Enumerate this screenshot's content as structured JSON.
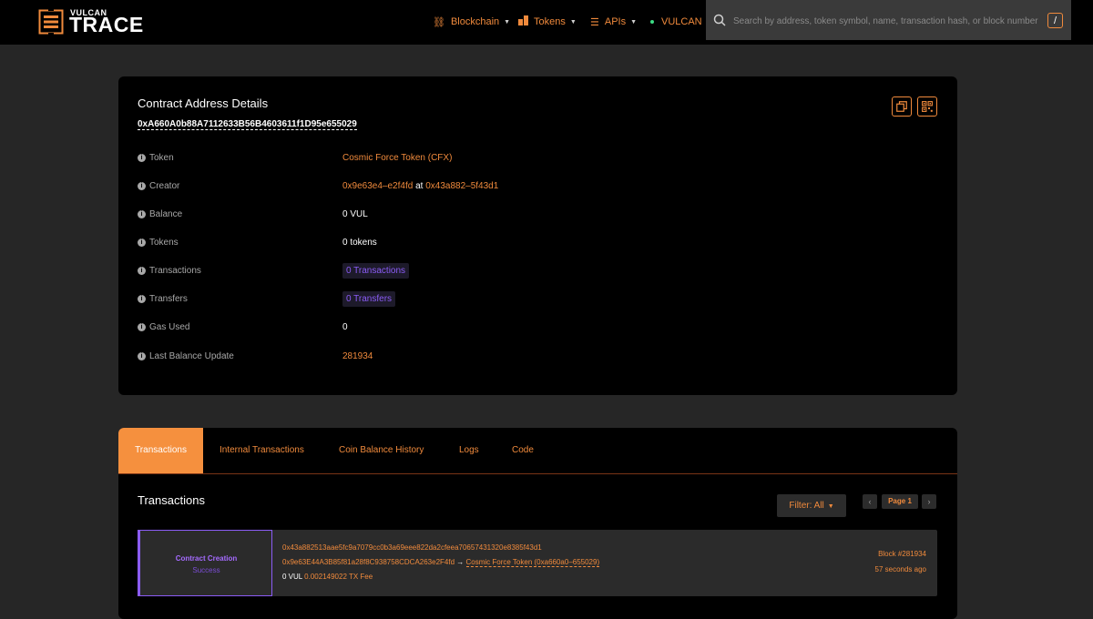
{
  "brand": {
    "small": "VULCAN",
    "big": "TRACE"
  },
  "nav": {
    "blockchain": "Blockchain",
    "tokens": "Tokens",
    "apis": "APIs",
    "network": "VULCAN"
  },
  "search": {
    "placeholder": "Search by address, token symbol, name, transaction hash, or block number",
    "shortcut": "/"
  },
  "details": {
    "title": "Contract Address Details",
    "address": "0xA660A0b88A7112633B56B4603611f1D95e655029",
    "rows": {
      "token": {
        "label": "Token",
        "value": "Cosmic Force Token (CFX)"
      },
      "creator": {
        "label": "Creator",
        "creator": "0x9e63e4–e2f4fd",
        "at": "at",
        "tx": "0x43a882–5f43d1"
      },
      "balance": {
        "label": "Balance",
        "value": "0 VUL"
      },
      "tokens": {
        "label": "Tokens",
        "value": "0 tokens"
      },
      "transactions": {
        "label": "Transactions",
        "value": "0 Transactions"
      },
      "transfers": {
        "label": "Transfers",
        "value": "0 Transfers"
      },
      "gas": {
        "label": "Gas Used",
        "value": "0"
      },
      "last_update": {
        "label": "Last Balance Update",
        "value": "281934"
      }
    }
  },
  "tabs": {
    "transactions": "Transactions",
    "internal": "Internal Transactions",
    "coin_balance": "Coin Balance History",
    "logs": "Logs",
    "code": "Code"
  },
  "tx_section": {
    "heading": "Transactions",
    "filter": "Filter: All",
    "page": "Page 1",
    "prev": "‹",
    "next": "›"
  },
  "tx": {
    "type": "Contract Creation",
    "status": "Success",
    "hash": "0x43a882513aae5fc9a7079cc0b3a69eee822da2cfeea70657431320e8385f43d1",
    "from": "0x9e63E44A3B85f81a28f8C938758CDCA263e2F4fd",
    "arrow": "→",
    "to": "Cosmic Force Token (0xa660a0–655029)",
    "value": "0 VUL",
    "fee": "0.002149022 TX Fee",
    "block": "Block #281934",
    "age": "57 seconds ago"
  },
  "colors": {
    "accent": "#f08a3c",
    "active_tab": "#f5903e",
    "purple": "#8b5cf6",
    "background": "#262626",
    "card": "#000000"
  }
}
